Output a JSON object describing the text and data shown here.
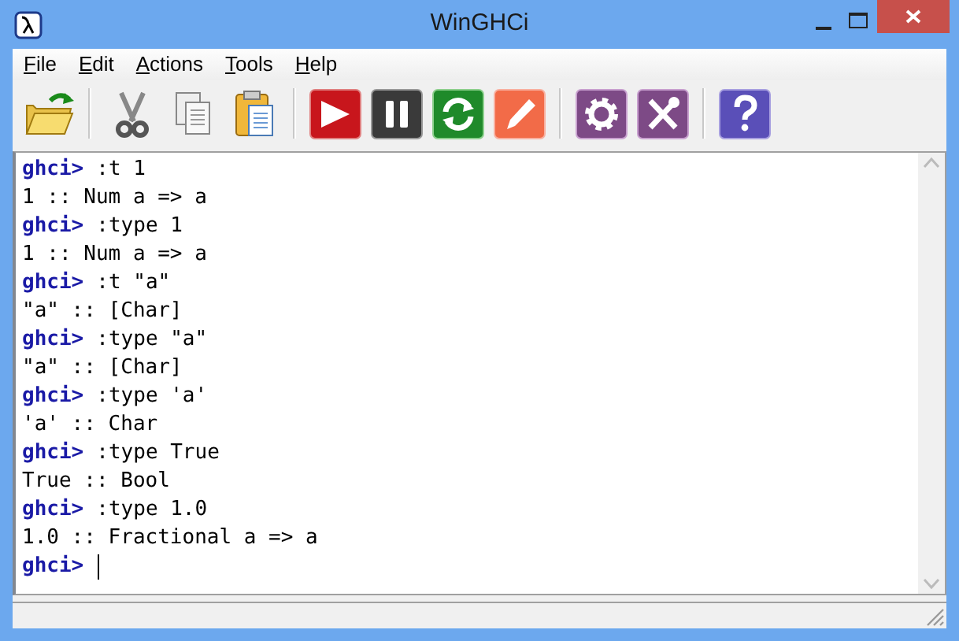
{
  "window": {
    "title": "WinGHCi"
  },
  "menu": [
    {
      "label": "File"
    },
    {
      "label": "Edit"
    },
    {
      "label": "Actions"
    },
    {
      "label": "Tools"
    },
    {
      "label": "Help"
    }
  ],
  "toolbar": [
    [
      {
        "kind": "open"
      }
    ],
    [
      {
        "kind": "cut"
      },
      {
        "kind": "copy"
      },
      {
        "kind": "paste"
      }
    ],
    [
      {
        "kind": "run"
      },
      {
        "kind": "pause"
      },
      {
        "kind": "reload"
      },
      {
        "kind": "edit"
      }
    ],
    [
      {
        "kind": "options"
      },
      {
        "kind": "tools"
      }
    ],
    [
      {
        "kind": "help"
      }
    ]
  ],
  "console": [
    {
      "kind": "prompt",
      "prompt": "ghci>",
      "text": ":t 1"
    },
    {
      "kind": "output",
      "text": "1 :: Num a => a"
    },
    {
      "kind": "prompt",
      "prompt": "ghci>",
      "text": ":type 1"
    },
    {
      "kind": "output",
      "text": "1 :: Num a => a"
    },
    {
      "kind": "prompt",
      "prompt": "ghci>",
      "text": ":t \"a\""
    },
    {
      "kind": "output",
      "text": "\"a\" :: [Char]"
    },
    {
      "kind": "prompt",
      "prompt": "ghci>",
      "text": ":type \"a\""
    },
    {
      "kind": "output",
      "text": "\"a\" :: [Char]"
    },
    {
      "kind": "prompt",
      "prompt": "ghci>",
      "text": ":type 'a'"
    },
    {
      "kind": "output",
      "text": "'a' :: Char"
    },
    {
      "kind": "prompt",
      "prompt": "ghci>",
      "text": ":type True"
    },
    {
      "kind": "output",
      "text": "True :: Bool"
    },
    {
      "kind": "prompt",
      "prompt": "ghci>",
      "text": ":type 1.0"
    },
    {
      "kind": "output",
      "text": "1.0 :: Fractional a => a"
    },
    {
      "kind": "input",
      "prompt": "ghci>"
    }
  ]
}
